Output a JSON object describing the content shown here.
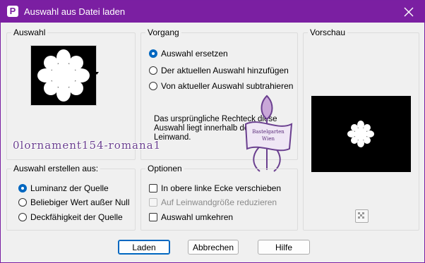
{
  "window": {
    "title": "Auswahl aus Datei laden"
  },
  "groups": {
    "auswahl": "Auswahl",
    "vorgang": "Vorgang",
    "vorschau": "Vorschau",
    "erstellen": "Auswahl erstellen aus:",
    "optionen": "Optionen"
  },
  "vorgang": {
    "options": [
      "Auswahl ersetzen",
      "Der aktuellen Auswahl hinzufügen",
      "Von aktueller Auswahl subtrahieren"
    ],
    "selected": 0,
    "info_line1": "Das ursprüngliche Rechteck diese",
    "info_line2": "Auswahl liegt innerhalb der",
    "info_line3": "Leinwand."
  },
  "erstellen": {
    "options": [
      "Luminanz der Quelle",
      "Beliebiger Wert außer Null",
      "Deckfähigkeit der Quelle"
    ],
    "selected": 0
  },
  "optionen": {
    "items": [
      {
        "label": "In obere linke Ecke verschieben",
        "checked": false,
        "disabled": false
      },
      {
        "label": "Auf Leinwandgröße reduzieren",
        "checked": false,
        "disabled": true
      },
      {
        "label": "Auswahl umkehren",
        "checked": false,
        "disabled": false
      }
    ]
  },
  "watermark": {
    "text": "0lornament154-romana1",
    "seal_line1": "Bastelgarten",
    "seal_line2": "Wien"
  },
  "buttons": {
    "load": "Laden",
    "cancel": "Abbrechen",
    "help": "Hilfe"
  },
  "colors": {
    "titlebar": "#7b1fa2",
    "accent": "#0067c0"
  }
}
